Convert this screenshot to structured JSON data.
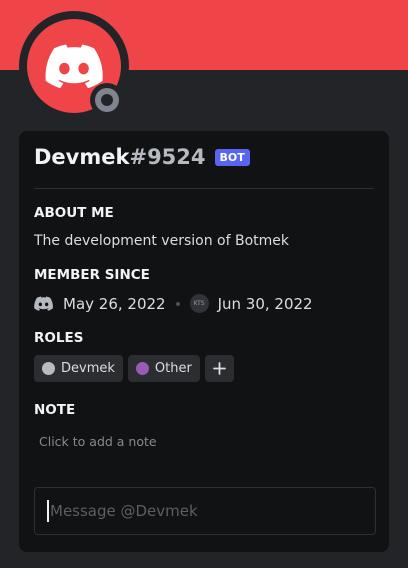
{
  "profile": {
    "username": "Devmek",
    "discriminator": "#9524",
    "bot_tag": "BOT"
  },
  "about": {
    "heading": "ABOUT ME",
    "text": "The development version of Botmek"
  },
  "member_since": {
    "heading": "MEMBER SINCE",
    "discord_date": "May 26, 2022",
    "server_icon_label": "KTS",
    "server_date": "Jun 30, 2022"
  },
  "roles": {
    "heading": "ROLES",
    "items": [
      {
        "name": "Devmek",
        "color": "#b9bbbe"
      },
      {
        "name": "Other",
        "color": "#9b59b6"
      }
    ],
    "add_label": "+"
  },
  "note": {
    "heading": "NOTE",
    "placeholder": "Click to add a note"
  },
  "message": {
    "placeholder": "Message @Devmek"
  },
  "colors": {
    "banner": "#ef4549",
    "bot_tag": "#5865f2",
    "status_offline": "#80848e"
  }
}
